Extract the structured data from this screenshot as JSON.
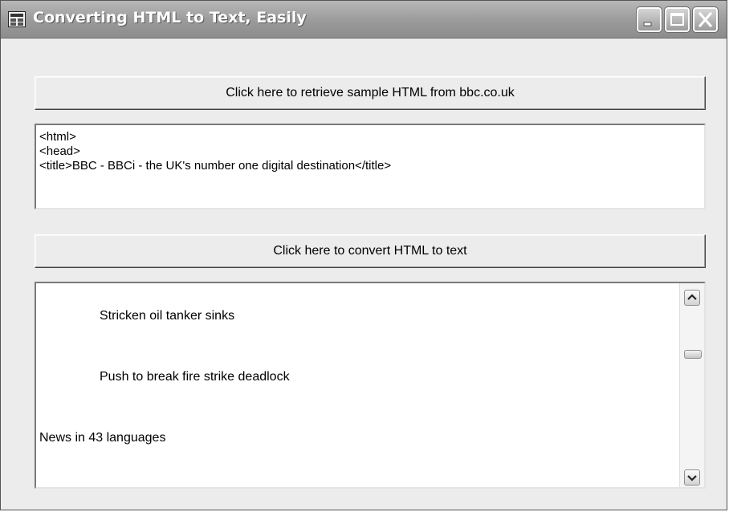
{
  "window": {
    "title": "Converting HTML to Text, Easily",
    "icons": {
      "app": "window-app-icon",
      "minimize": "minimize-icon",
      "maximize": "maximize-icon",
      "close": "close-icon"
    }
  },
  "retrieve_button": {
    "label": "Click here to retrieve sample HTML from bbc.co.uk"
  },
  "html_box": {
    "lines": [
      "<html>",
      "<head>",
      "<title>BBC - BBCi - the UK's number one digital destination</title>"
    ]
  },
  "convert_button": {
    "label": "Click here to convert HTML to text"
  },
  "text_box": {
    "lines": [
      "Stricken oil tanker sinks",
      "Push to break fire strike deadlock",
      "News in 43 languages"
    ],
    "scrollbar": {
      "icons": {
        "up": "scroll-up-icon",
        "down": "scroll-down-icon"
      }
    }
  }
}
